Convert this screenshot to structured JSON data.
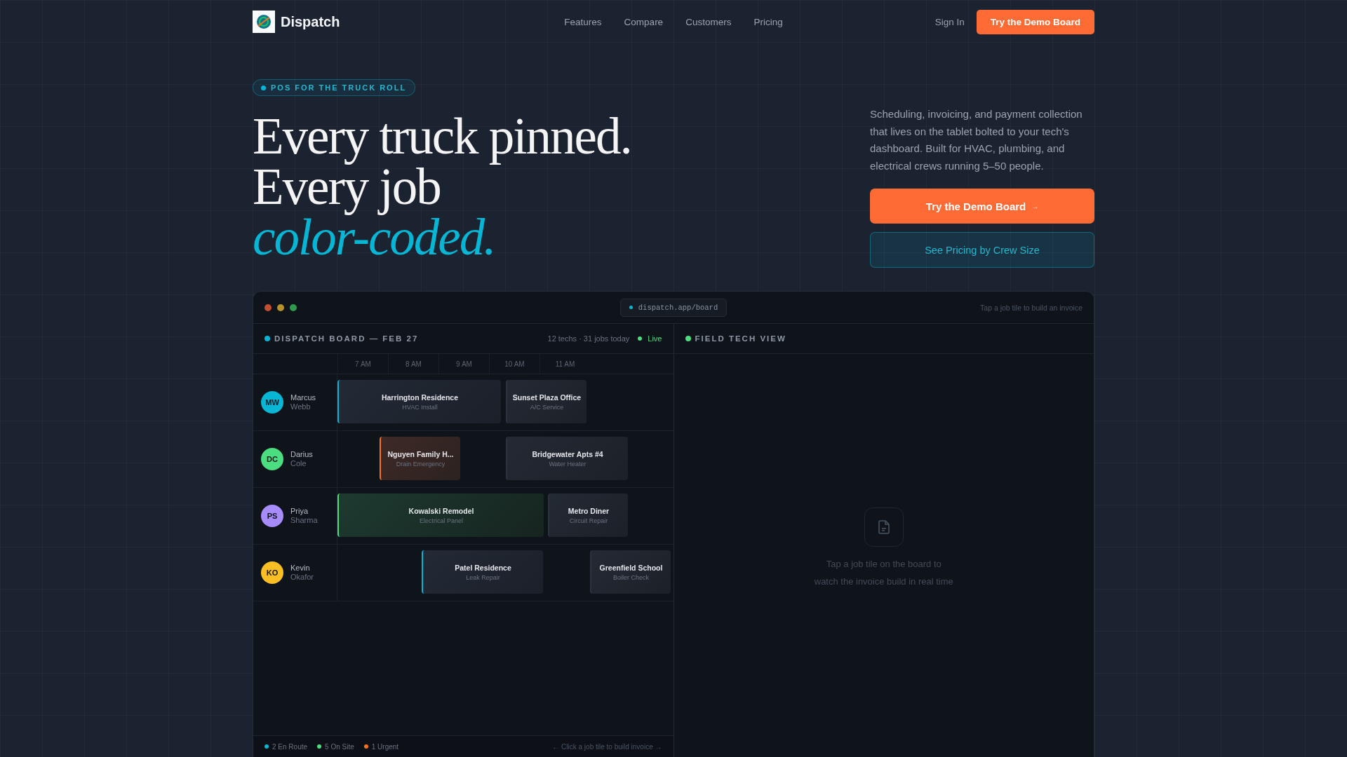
{
  "nav": {
    "brand": "Dispatch",
    "links": [
      "Features",
      "Compare",
      "Customers",
      "Pricing"
    ],
    "sign_in": "Sign In",
    "cta": "Try the Demo Board"
  },
  "hero": {
    "badge": "POS FOR THE TRUCK ROLL",
    "headline_lines": [
      "Every truck pinned.",
      "Every job"
    ],
    "headline_accent": "color-coded.",
    "description": "Scheduling, invoicing, and payment collection that lives on the tablet bolted to your tech's dashboard. Built for HVAC, plumbing, and electrical crews running 5–50 people.",
    "primary_button": "Try the Demo Board",
    "primary_arrow": "→",
    "secondary_button": "See Pricing by Crew Size"
  },
  "board_window": {
    "url": "dispatch.app/board",
    "hint": "Tap a job tile to build an invoice",
    "board": {
      "title": "DISPATCH BOARD — FEB 27",
      "summary": "12 techs · 31 jobs today",
      "live": "Live",
      "hours": [
        "7 AM",
        "8 AM",
        "9 AM",
        "10 AM",
        "11 AM"
      ],
      "techs": [
        {
          "initials": "MW",
          "first": "Marcus",
          "last": "Webb",
          "color": "#06b6d4",
          "jobs": [
            {
              "name": "Harrington Residence",
              "service": "HVAC Install",
              "kind": "enroute"
            },
            {
              "name": "Sunset Plaza Office",
              "service": "A/C Service",
              "kind": "scheduled"
            }
          ]
        },
        {
          "initials": "DC",
          "first": "Darius",
          "last": "Cole",
          "color": "#4ade80",
          "jobs": [
            {
              "name": "Nguyen Family H...",
              "service": "Drain Emergency",
              "kind": "urgent"
            },
            {
              "name": "Bridgewater Apts #4",
              "service": "Water Heater",
              "kind": "scheduled"
            }
          ]
        },
        {
          "initials": "PS",
          "first": "Priya",
          "last": "Sharma",
          "color": "#a78bfa",
          "jobs": [
            {
              "name": "Kowalski Remodel",
              "service": "Electrical Panel",
              "kind": "onsite"
            },
            {
              "name": "Metro Diner",
              "service": "Circuit Repair",
              "kind": "scheduled"
            }
          ]
        },
        {
          "initials": "KO",
          "first": "Kevin",
          "last": "Okafor",
          "color": "#fbbf24",
          "jobs": [
            {
              "name": "Patel Residence",
              "service": "Leak Repair",
              "kind": "enroute"
            },
            {
              "name": "Greenfield School",
              "service": "Boiler Check",
              "kind": "scheduled"
            }
          ]
        }
      ],
      "legend": [
        {
          "label": "2 En Route",
          "color": "#06b6d4"
        },
        {
          "label": "5 On Site",
          "color": "#4ade80"
        },
        {
          "label": "1 Urgent",
          "color": "#f97316"
        }
      ],
      "footer_hint": "← Click a job tile to build invoice →"
    },
    "field_view": {
      "title": "FIELD TECH VIEW",
      "empty_lines": [
        "Tap a job tile on the board to",
        "watch the invoice build in real time"
      ]
    }
  }
}
